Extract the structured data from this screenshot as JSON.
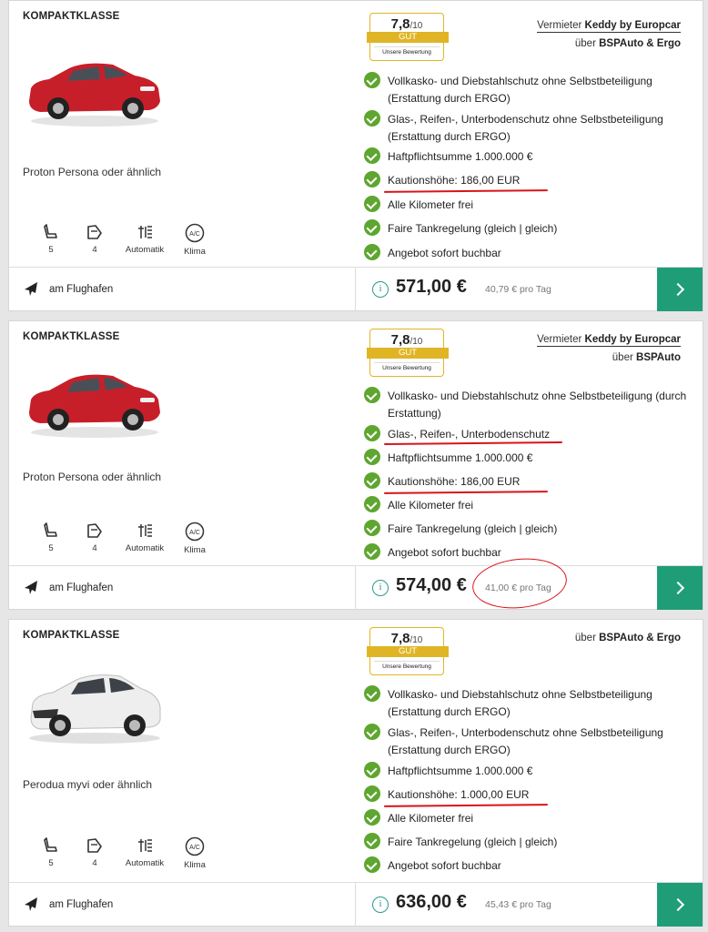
{
  "offers": [
    {
      "category": "KOMPAKTKLASSE",
      "model": "Proton Persona oder ähnlich",
      "car_color": "#c71f2a",
      "rating": {
        "score": "7,8",
        "scale": "/10",
        "label": "GUT",
        "note": "Unsere Bewertung"
      },
      "vendor": {
        "prefix": "Vermieter",
        "name": "Keddy by Europcar",
        "via_prefix": "über",
        "via": "BSPAuto & Ergo"
      },
      "features": [
        "Vollkasko- und Diebstahlschutz ohne Selbstbeteiligung (Erstattung durch ERGO)",
        "Glas-, Reifen-, Unterbodenschutz ohne Selbstbeteiligung (Erstattung durch ERGO)",
        "Haftpflichtsumme 1.000.000 €",
        "Kautionshöhe: 186,00 EUR",
        "Alle Kilometer frei",
        "Faire Tankregelung (gleich | gleich)",
        "Angebot sofort buchbar"
      ],
      "specs": [
        {
          "icon": "seat-icon",
          "label": "5"
        },
        {
          "icon": "door-icon",
          "label": "4"
        },
        {
          "icon": "gearbox-icon",
          "label": "Automatik"
        },
        {
          "icon": "ac-icon",
          "label": "Klima"
        }
      ],
      "location": "am Flughafen",
      "price": "571,00 €",
      "per_day": "40,79 € pro Tag"
    },
    {
      "category": "KOMPAKTKLASSE",
      "model": "Proton Persona oder ähnlich",
      "car_color": "#c71f2a",
      "rating": {
        "score": "7,8",
        "scale": "/10",
        "label": "GUT",
        "note": "Unsere Bewertung"
      },
      "vendor": {
        "prefix": "Vermieter",
        "name": "Keddy by Europcar",
        "via_prefix": "über",
        "via": "BSPAuto"
      },
      "features": [
        "Vollkasko- und Diebstahlschutz ohne Selbstbeteiligung (durch Erstattung)",
        "Glas-, Reifen-, Unterbodenschutz",
        "Haftpflichtsumme 1.000.000 €",
        "Kautionshöhe: 186,00 EUR",
        "Alle Kilometer frei",
        "Faire Tankregelung (gleich | gleich)",
        "Angebot sofort buchbar"
      ],
      "specs": [
        {
          "icon": "seat-icon",
          "label": "5"
        },
        {
          "icon": "door-icon",
          "label": "4"
        },
        {
          "icon": "gearbox-icon",
          "label": "Automatik"
        },
        {
          "icon": "ac-icon",
          "label": "Klima"
        }
      ],
      "location": "am Flughafen",
      "price": "574,00 €",
      "per_day": "41,00 € pro Tag"
    },
    {
      "category": "KOMPAKTKLASSE",
      "model": "Perodua myvi oder ähnlich",
      "car_color": "#eeeeee",
      "rating": {
        "score": "7,8",
        "scale": "/10",
        "label": "GUT",
        "note": "Unsere Bewertung"
      },
      "vendor": {
        "via_prefix": "über",
        "via": "BSPAuto & Ergo"
      },
      "features": [
        "Vollkasko- und Diebstahlschutz ohne Selbstbeteiligung (Erstattung durch ERGO)",
        "Glas-, Reifen-, Unterbodenschutz ohne Selbstbeteiligung (Erstattung durch ERGO)",
        "Haftpflichtsumme 1.000.000 €",
        "Kautionshöhe: 1.000,00 EUR",
        "Alle Kilometer frei",
        "Faire Tankregelung (gleich | gleich)",
        "Angebot sofort buchbar"
      ],
      "specs": [
        {
          "icon": "seat-icon",
          "label": "5"
        },
        {
          "icon": "door-icon",
          "label": "4"
        },
        {
          "icon": "gearbox-icon",
          "label": "Automatik"
        },
        {
          "icon": "ac-icon",
          "label": "Klima"
        }
      ],
      "location": "am Flughafen",
      "price": "636,00 €",
      "per_day": "45,43 € pro Tag"
    }
  ],
  "colors": {
    "accent_green": "#1f9d77",
    "check_green": "#5ea62f",
    "rating_gold": "#e0b525",
    "annotation_red": "#d8141a"
  }
}
